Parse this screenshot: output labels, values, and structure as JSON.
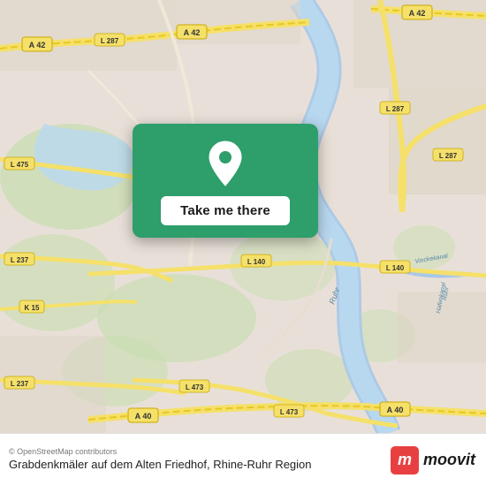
{
  "map": {
    "background_color": "#e8e0d8"
  },
  "tooltip": {
    "button_label": "Take me there",
    "pin_color": "#ffffff",
    "card_color": "#2e9e6b"
  },
  "bottom_bar": {
    "copyright": "© OpenStreetMap contributors",
    "place_name": "Grabdenkmäler auf dem Alten Friedhof, Rhine-Ruhr Region"
  },
  "moovit": {
    "logo_letter": "m",
    "wordmark": "moovit"
  },
  "road_labels": {
    "a42_1": "A 42",
    "a42_2": "A 42",
    "a42_3": "A 42",
    "l287_1": "L 287",
    "l287_2": "L 287",
    "l475": "L 475",
    "l237_1": "L 237",
    "l237_2": "L 237",
    "l140_1": "L 140",
    "l140_2": "L 140",
    "k15": "K 15",
    "l473_1": "L 473",
    "l473_2": "L 473",
    "a40_1": "A 40",
    "a40_2": "A 40",
    "ruhr": "Ruhr",
    "vinckekanal": "Vinckekanal",
    "hafenkanal": "Hafenkanal",
    "ruhr2": "Ruhr"
  }
}
